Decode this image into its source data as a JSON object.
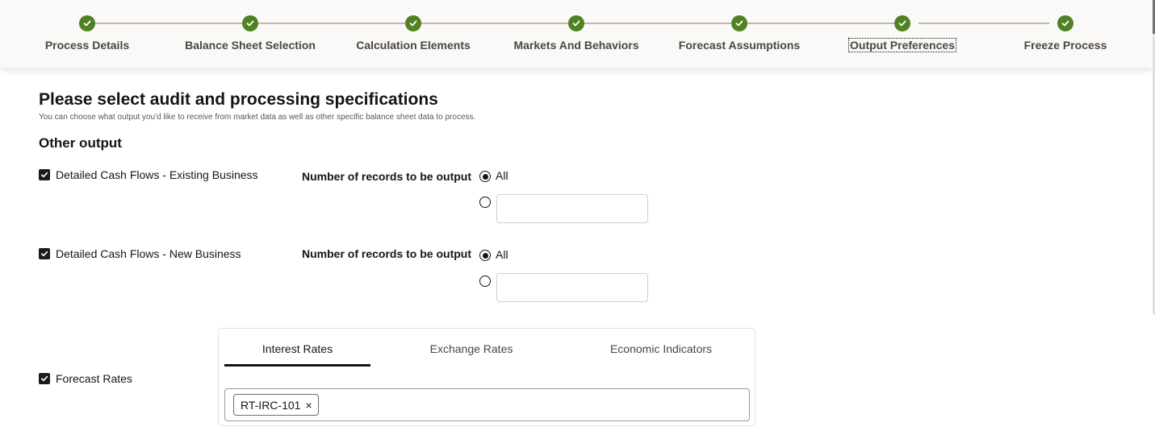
{
  "stepper": {
    "steps": [
      {
        "label": "Process Details",
        "status": "complete"
      },
      {
        "label": "Balance Sheet Selection",
        "status": "complete"
      },
      {
        "label": "Calculation Elements",
        "status": "complete"
      },
      {
        "label": "Markets And Behaviors",
        "status": "complete"
      },
      {
        "label": "Forecast Assumptions",
        "status": "complete"
      },
      {
        "label": "Output Preferences",
        "status": "current"
      },
      {
        "label": "Freeze Process",
        "status": "complete"
      }
    ],
    "check_icon": "check-icon",
    "complete_color": "#508223"
  },
  "page": {
    "title": "Please select audit and processing specifications",
    "subtitle": "You can choose what output you'd like to receive from market data as well as other specific balance sheet data to process."
  },
  "other_output": {
    "title": "Other output",
    "existing_business": {
      "label": "Detailed Cash Flows - Existing Business",
      "checked": true,
      "records_label": "Number of records to be output",
      "option_all": "All",
      "selected": "All",
      "custom_value": ""
    },
    "new_business": {
      "label": "Detailed Cash Flows - New Business",
      "checked": true,
      "records_label": "Number of records to be output",
      "option_all": "All",
      "selected": "All",
      "custom_value": ""
    },
    "forecast_rates": {
      "label": "Forecast Rates",
      "checked": true,
      "tabs": [
        {
          "label": "Interest Rates",
          "active": true
        },
        {
          "label": "Exchange Rates",
          "active": false
        },
        {
          "label": "Economic Indicators",
          "active": false
        }
      ],
      "selected_chips": [
        {
          "label": "RT-IRC-101",
          "remove_icon": "×"
        }
      ]
    }
  }
}
